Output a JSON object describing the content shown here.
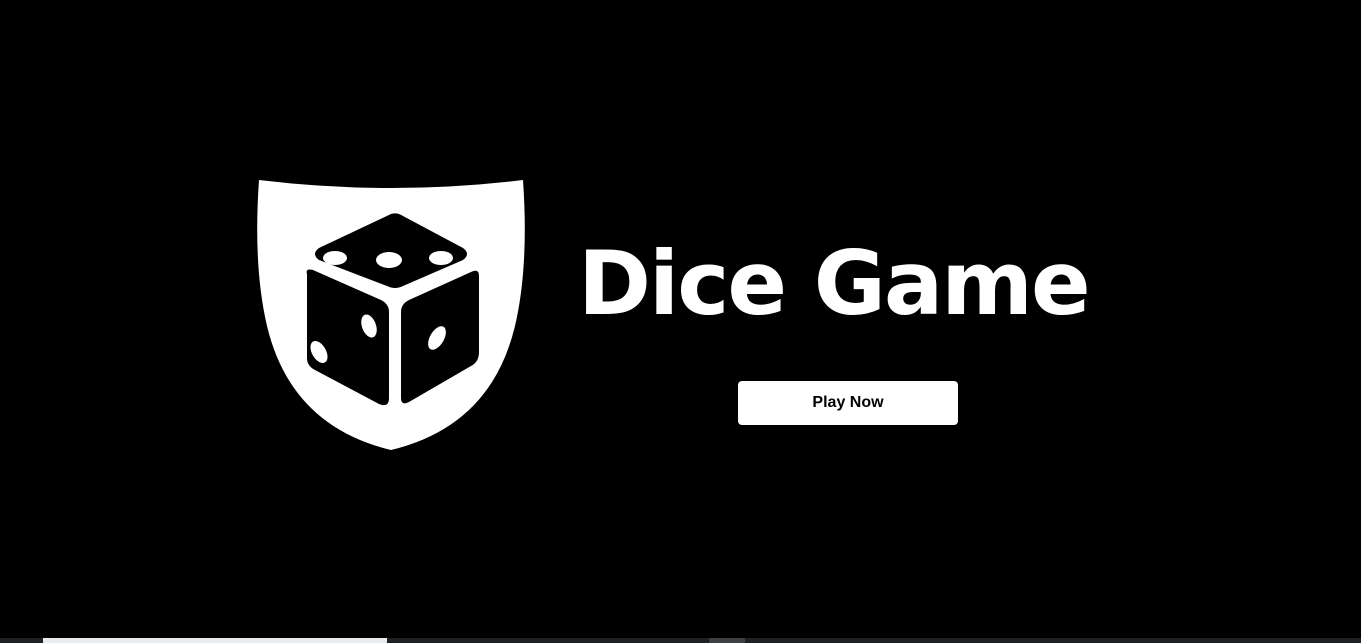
{
  "app": {
    "title": "Dice Game"
  },
  "logo": {
    "icon": "dice-shield-icon"
  },
  "actions": {
    "play_label": "Play Now"
  },
  "colors": {
    "background": "#000000",
    "foreground": "#ffffff",
    "button_text": "#000000"
  }
}
